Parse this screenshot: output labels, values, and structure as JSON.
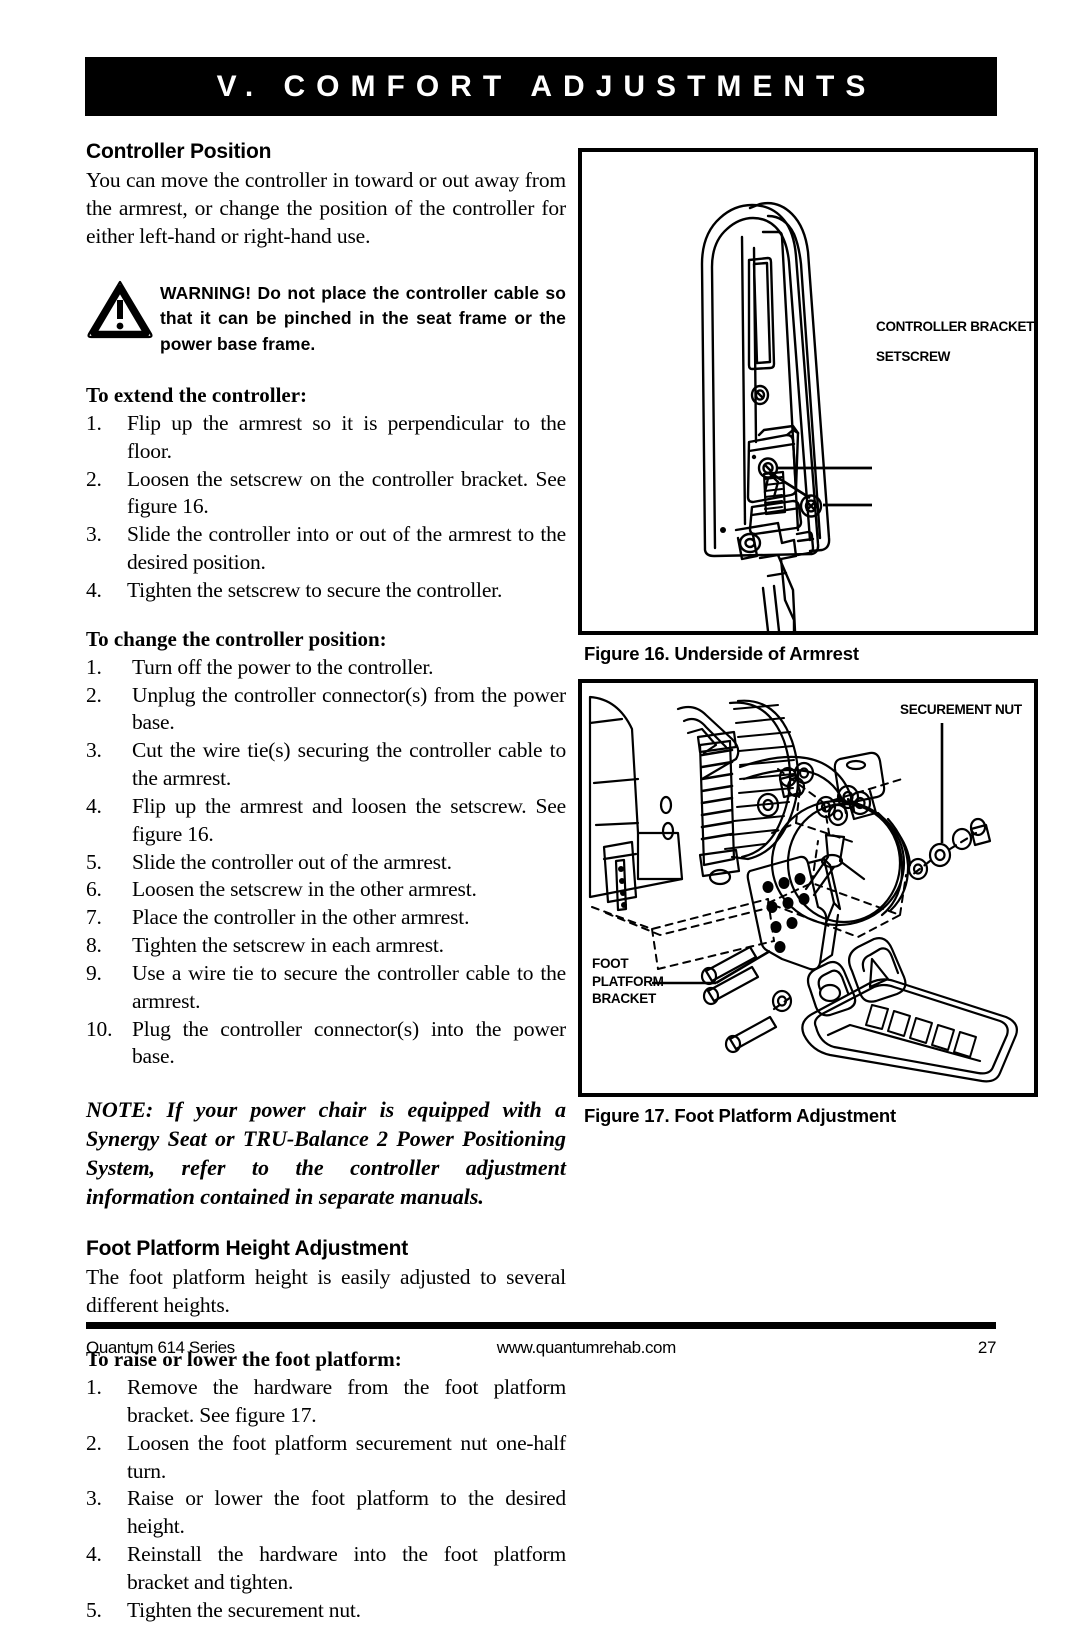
{
  "header": {
    "title": "V.  COMFORT  ADJUSTMENTS"
  },
  "left_column": {
    "section1": {
      "heading": "Controller Position",
      "intro": "You can move the controller in toward or out away from the armrest, or change the position of the controller for either left-hand or right-hand use.",
      "warning": {
        "icon": "warning-triangle-icon",
        "text": "WARNING! Do not place the controller cable so that it can be pinched in the seat frame or the power base frame."
      },
      "procedure1": {
        "heading": "To extend the controller:",
        "steps": [
          {
            "num": "1.",
            "text": "Flip up the armrest so it is perpendicular to the floor."
          },
          {
            "num": "2.",
            "text": "Loosen the setscrew on the controller bracket. See figure 16."
          },
          {
            "num": "3.",
            "text": "Slide the controller into or out of the armrest to the desired position."
          },
          {
            "num": "4.",
            "text": "Tighten the setscrew to secure the controller."
          }
        ]
      },
      "procedure2": {
        "heading": "To change the controller position:",
        "steps": [
          {
            "num": "1.",
            "text": "Turn off the power to the controller."
          },
          {
            "num": "2.",
            "text": "Unplug the controller connector(s) from the power base."
          },
          {
            "num": "3.",
            "text": "Cut the wire tie(s) securing the controller cable to the armrest."
          },
          {
            "num": "4.",
            "text": "Flip up the armrest and loosen the setscrew. See figure 16."
          },
          {
            "num": "5.",
            "text": "Slide the controller out of the armrest."
          },
          {
            "num": "6.",
            "text": "Loosen the setscrew in the other armrest."
          },
          {
            "num": "7.",
            "text": "Place the controller in the other armrest."
          },
          {
            "num": "8.",
            "text": "Tighten the setscrew in each armrest."
          },
          {
            "num": "9.",
            "text": "Use a wire tie to secure the controller cable to the armrest."
          },
          {
            "num": "10.",
            "text": "Plug the controller connector(s) into the power base."
          }
        ]
      },
      "note": "NOTE: If your power chair is equipped with a Synergy Seat or TRU-Balance 2 Power Positioning System, refer to the controller adjustment information contained in separate manuals."
    },
    "section2": {
      "heading": "Foot Platform Height Adjustment",
      "intro": "The foot platform height is easily adjusted to several different heights.",
      "procedure": {
        "heading": "To raise or lower the foot platform:",
        "steps": [
          {
            "num": "1.",
            "text": "Remove the hardware from the foot platform bracket. See figure 17."
          },
          {
            "num": "2.",
            "text": "Loosen the foot platform securement nut one-half turn."
          },
          {
            "num": "3.",
            "text": "Raise or lower the foot platform to the desired height."
          },
          {
            "num": "4.",
            "text": "Reinstall the hardware into the foot platform bracket and tighten."
          },
          {
            "num": "5.",
            "text": "Tighten the securement nut."
          }
        ]
      }
    }
  },
  "figures": [
    {
      "id": "figure-16",
      "caption": "Figure 16. Underside of Armrest",
      "labels": [
        {
          "text": "CONTROLLER BRACKET"
        },
        {
          "text": "SETSCREW"
        }
      ]
    },
    {
      "id": "figure-17",
      "caption": "Figure 17. Foot Platform Adjustment",
      "labels": [
        {
          "text": "SECUREMENT NUT"
        },
        {
          "line1": "FOOT",
          "line2": "PLATFORM",
          "line3": "BRACKET"
        }
      ]
    }
  ],
  "footer": {
    "left": "Quantum 614 Series",
    "center": "www.quantumrehab.com",
    "right": "27"
  }
}
